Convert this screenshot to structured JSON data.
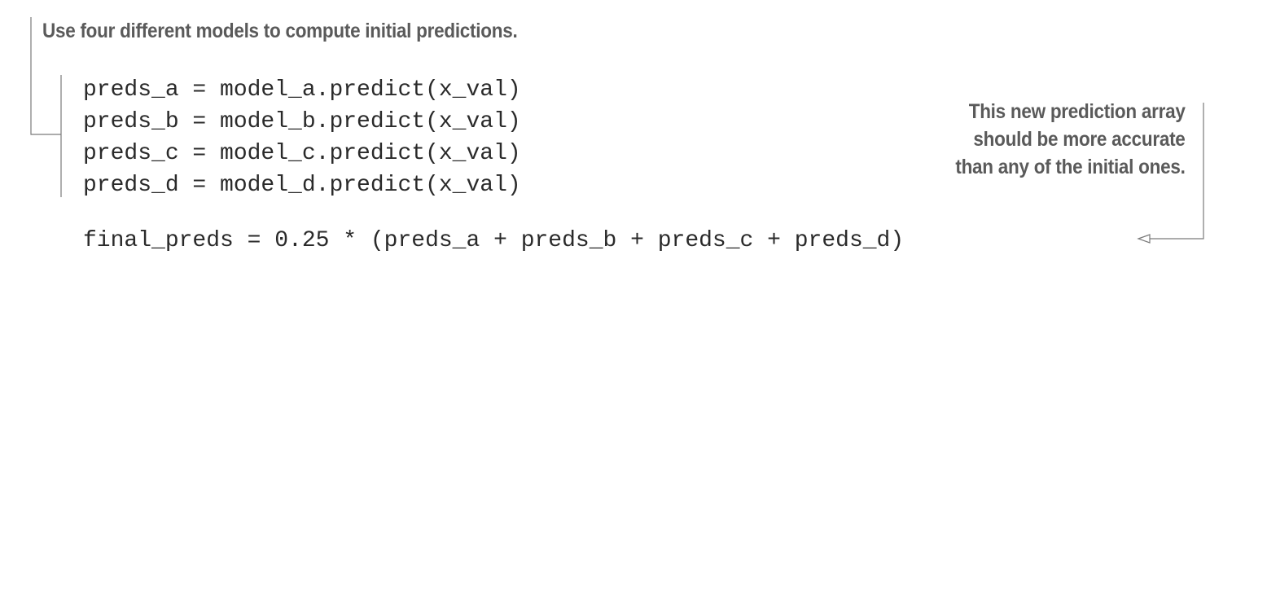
{
  "annotations": {
    "top": "Use four different models to compute initial predictions.",
    "right_lines": [
      "This new prediction array",
      "should be more accurate",
      "than any of the initial ones."
    ]
  },
  "code": {
    "lines": [
      "preds_a = model_a.predict(x_val)",
      "preds_b = model_b.predict(x_val)",
      "preds_c = model_c.predict(x_val)",
      "preds_d = model_d.predict(x_val)"
    ],
    "final_line": "final_preds = 0.25 * (preds_a + preds_b + preds_c + preds_d)"
  },
  "colors": {
    "annotation_text": "#5a5a5a",
    "code_text": "#2a2a2a",
    "callout_line": "#7a7a7a"
  }
}
